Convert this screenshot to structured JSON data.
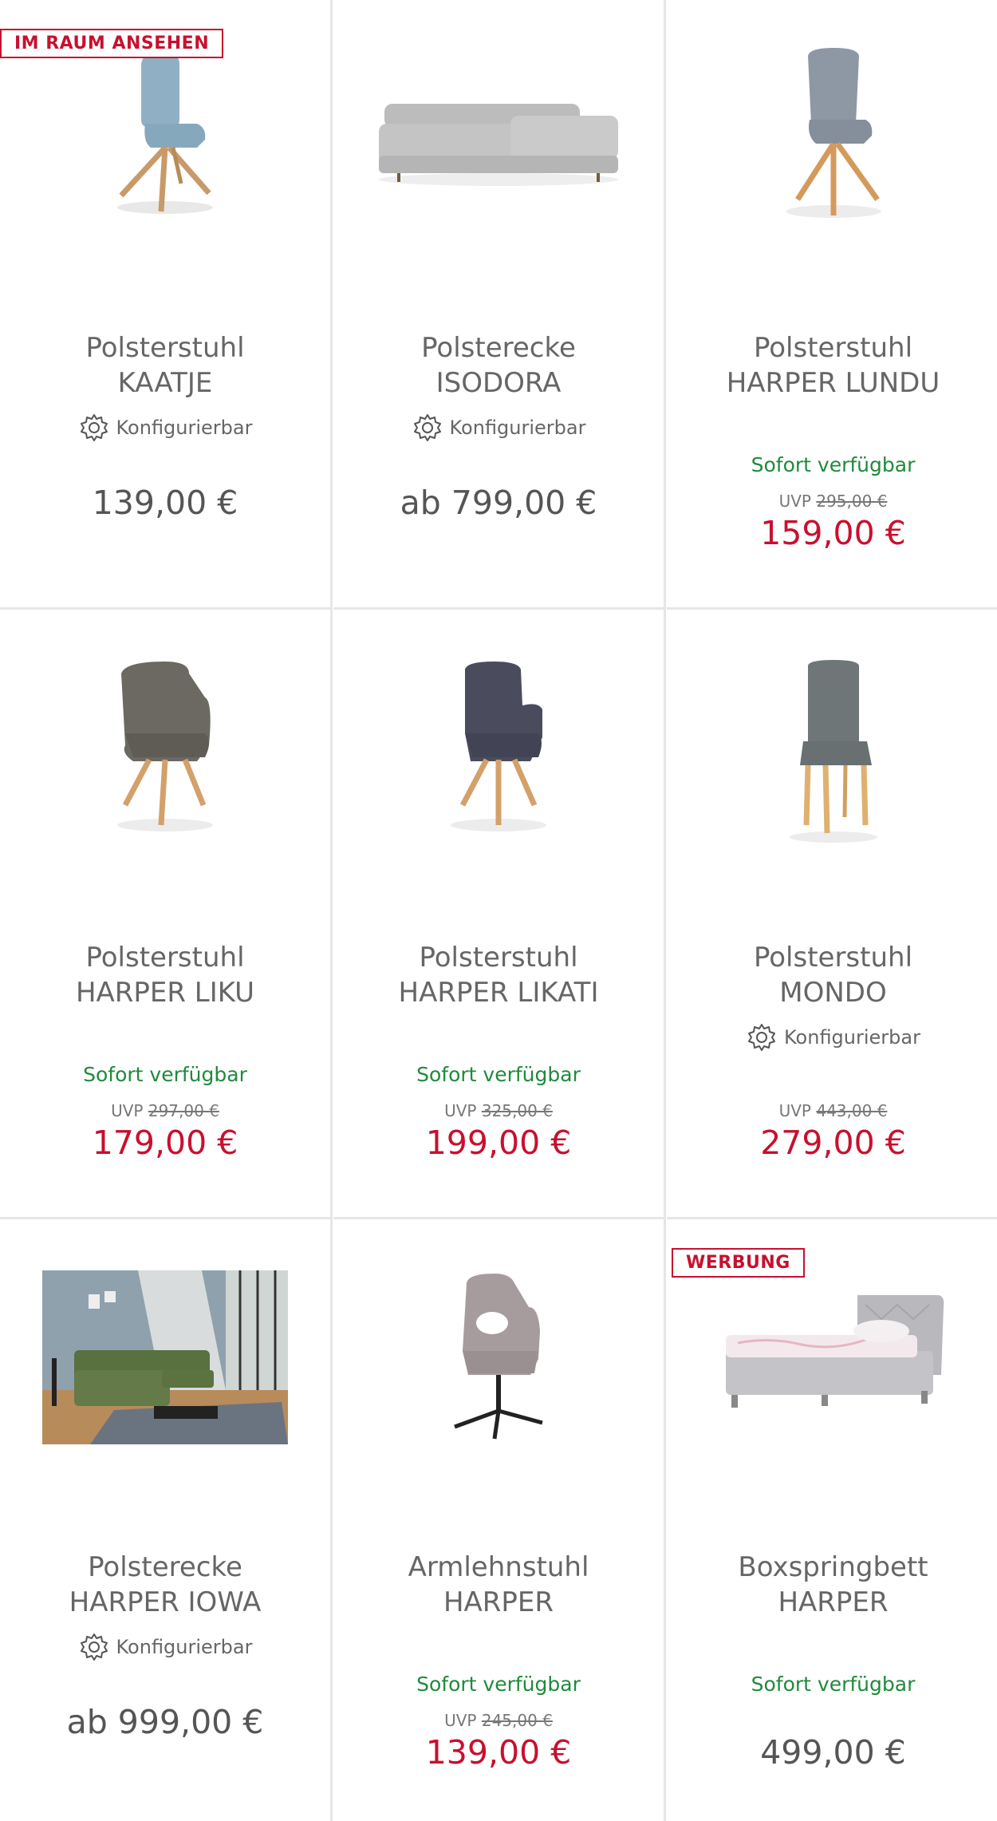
{
  "labels": {
    "configurable": "Konfigurierbar",
    "available": "Sofort verfügbar",
    "uvp_prefix": "UVP"
  },
  "colors": {
    "accent_red": "#c8102e",
    "available_green": "#1f8a3b",
    "divider": "#e6e6e6"
  },
  "products": [
    {
      "name_line1": "Polsterstuhl",
      "name_line2": "KAATJE",
      "badge": "IM RAUM ANSEHEN",
      "configurable": true,
      "available": false,
      "uvp": "",
      "price": "139,00 €",
      "sale": false,
      "image": "chair-blue-icon"
    },
    {
      "name_line1": "Polsterecke",
      "name_line2": "ISODORA",
      "badge": "",
      "configurable": true,
      "available": false,
      "uvp": "",
      "price": "ab 799,00 €",
      "sale": false,
      "image": "sofa-grey-icon"
    },
    {
      "name_line1": "Polsterstuhl",
      "name_line2": "HARPER LUNDU",
      "badge": "",
      "configurable": false,
      "available": true,
      "uvp": "295,00 €",
      "price": "159,00 €",
      "sale": true,
      "image": "chair-grey-icon"
    },
    {
      "name_line1": "Polsterstuhl",
      "name_line2": "HARPER LIKU",
      "badge": "",
      "configurable": false,
      "available": true,
      "uvp": "297,00 €",
      "price": "179,00 €",
      "sale": true,
      "image": "armchair-olive-icon"
    },
    {
      "name_line1": "Polsterstuhl",
      "name_line2": "HARPER LIKATI",
      "badge": "",
      "configurable": false,
      "available": true,
      "uvp": "325,00 €",
      "price": "199,00 €",
      "sale": true,
      "image": "armchair-navy-icon"
    },
    {
      "name_line1": "Polsterstuhl",
      "name_line2": "MONDO",
      "badge": "",
      "configurable": true,
      "available": false,
      "uvp": "443,00 €",
      "price": "279,00 €",
      "sale": true,
      "image": "dining-chair-grey-icon"
    },
    {
      "name_line1": "Polsterecke",
      "name_line2": "HARPER IOWA",
      "badge": "",
      "configurable": true,
      "available": false,
      "uvp": "",
      "price": "ab 999,00 €",
      "sale": false,
      "image": "sofa-green-room-photo"
    },
    {
      "name_line1": "Armlehnstuhl",
      "name_line2": "HARPER",
      "badge": "",
      "configurable": false,
      "available": true,
      "uvp": "245,00 €",
      "price": "139,00 €",
      "sale": true,
      "image": "swivel-chair-taupe-icon"
    },
    {
      "name_line1": "Boxspringbett",
      "name_line2": "HARPER",
      "badge": "WERBUNG",
      "configurable": false,
      "available": true,
      "uvp": "",
      "price": "499,00 €",
      "sale": false,
      "image": "bed-grey-icon"
    }
  ]
}
